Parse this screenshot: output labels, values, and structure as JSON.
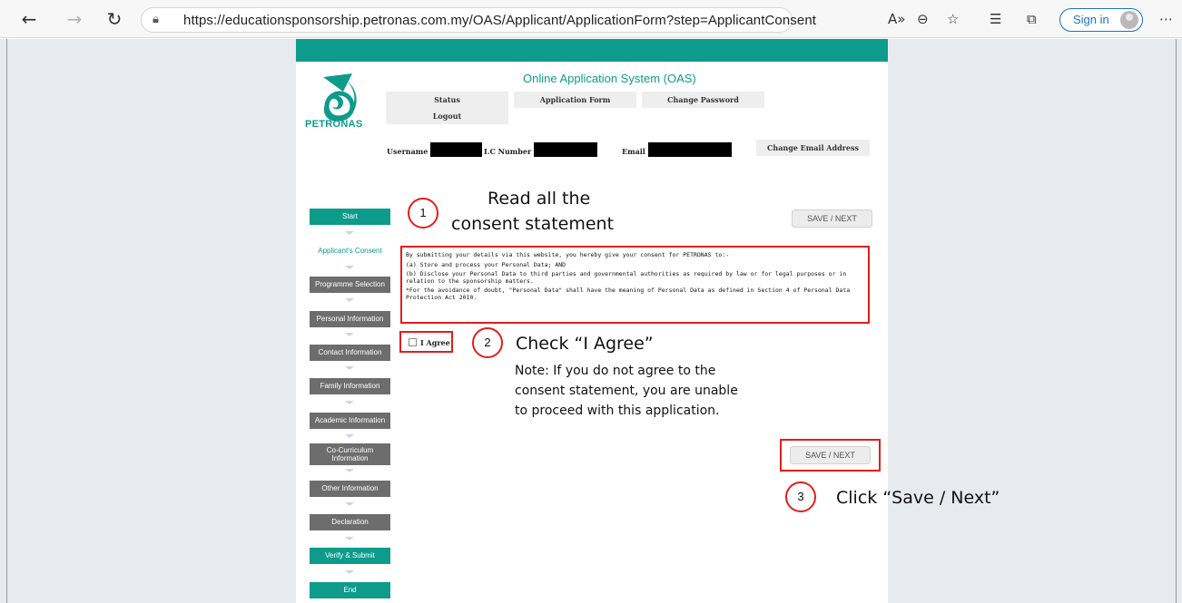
{
  "browser": {
    "url": "https://educationsponsorship.petronas.com.my/OAS/Applicant/ApplicationForm?step=ApplicantConsent",
    "sign_in": "Sign in"
  },
  "header": {
    "logo_text": "PETRONAS",
    "title": "Online Application System (OAS)",
    "menu": {
      "status": "Status",
      "application_form": "Application Form",
      "change_password": "Change Password",
      "logout": "Logout"
    },
    "username_label": "Username :",
    "ic_label": "I.C Number :",
    "email_label": "Email :",
    "change_email": "Change Email Address"
  },
  "steps": [
    "Start",
    "Applicant's Consent",
    "Programme Selection",
    "Personal Information",
    "Contact Information",
    "Family Information",
    "Academic Information",
    "Co-Curriculum Information",
    "Other Information",
    "Declaration",
    "Verify & Submit",
    "End"
  ],
  "buttons": {
    "save_next_top": "SAVE / NEXT",
    "save_next_bottom": "SAVE / NEXT"
  },
  "consent": {
    "intro": "By submitting your details via this website, you hereby give your consent for PETRONAS to:-",
    "item_a": "(a) Store and process your Personal Data; AND",
    "item_b": "(b) Disclose your Personal Data to third parties and governmental authorities as required by law or for legal purposes or in relation to the sponsorship matters.",
    "note": "*For the avoidance of doubt, \"Personal Data\" shall have the meaning of Personal Data as defined in Section 4 of Personal Data Protection Act 2010.",
    "agree_label": "I Agree"
  },
  "annotations": {
    "step1_num": "1",
    "step1_line1": "Read all the",
    "step1_line2": "consent statement",
    "step2_num": "2",
    "step2_text": "Check “I Agree”",
    "note_line1": "Note: If you do not agree to the",
    "note_line2": "consent statement, you are unable",
    "note_line3": "to proceed with this application.",
    "step3_num": "3",
    "step3_text": "Click “Save / Next”"
  },
  "colors": {
    "brand_teal": "#0d9b8b",
    "step_grey": "#6d6d6d",
    "highlight_red": "#e31d1d"
  }
}
